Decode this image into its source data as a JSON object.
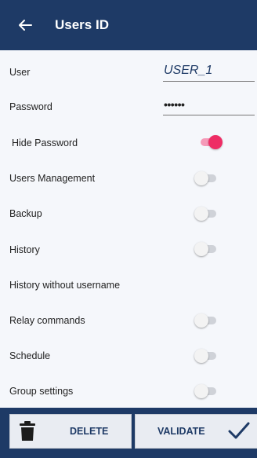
{
  "header": {
    "title": "Users ID",
    "back_icon": "arrow-left-icon"
  },
  "form": {
    "user_label": "User",
    "user_value": "USER_1",
    "password_label": "Password",
    "password_value": "••••••"
  },
  "toggles": [
    {
      "label": "Hide Password",
      "on": true
    },
    {
      "label": "Users Management",
      "on": false
    },
    {
      "label": "Backup",
      "on": false
    },
    {
      "label": "History",
      "on": false
    },
    {
      "label": "History without username"
    },
    {
      "label": "Relay commands",
      "on": false
    },
    {
      "label": "Schedule",
      "on": false
    },
    {
      "label": "Group settings",
      "on": false
    }
  ],
  "actions": {
    "delete_label": "DELETE",
    "validate_label": "VALIDATE",
    "delete_icon": "trash-icon",
    "validate_icon": "check-icon"
  },
  "colors": {
    "primary": "#1e3a66",
    "accent": "#ee2d65",
    "background": "#f5f7fb"
  }
}
